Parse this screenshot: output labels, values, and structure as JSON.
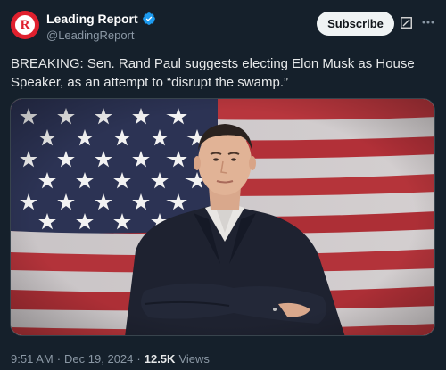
{
  "account": {
    "display_name": "Leading Report",
    "handle": "@LeadingReport",
    "avatar_letter": "R"
  },
  "actions": {
    "subscribe_label": "Subscribe",
    "grok_icon": "grok-icon",
    "more_icon": "more-icon"
  },
  "tweet": {
    "text": "BREAKING: Sen. Rand Paul suggests electing Elon Musk as House Speaker, as an attempt to “disrupt the swamp.”"
  },
  "media": {
    "description": "photo"
  },
  "meta": {
    "time": "9:51 AM",
    "separator": "·",
    "date": "Dec 19, 2024",
    "views_count": "12.5K",
    "views_label": "Views"
  },
  "colors": {
    "background": "#15202b",
    "accent_verified": "#1d9bf0",
    "avatar_brand": "#e0202e",
    "secondary_text": "#8b98a5"
  }
}
